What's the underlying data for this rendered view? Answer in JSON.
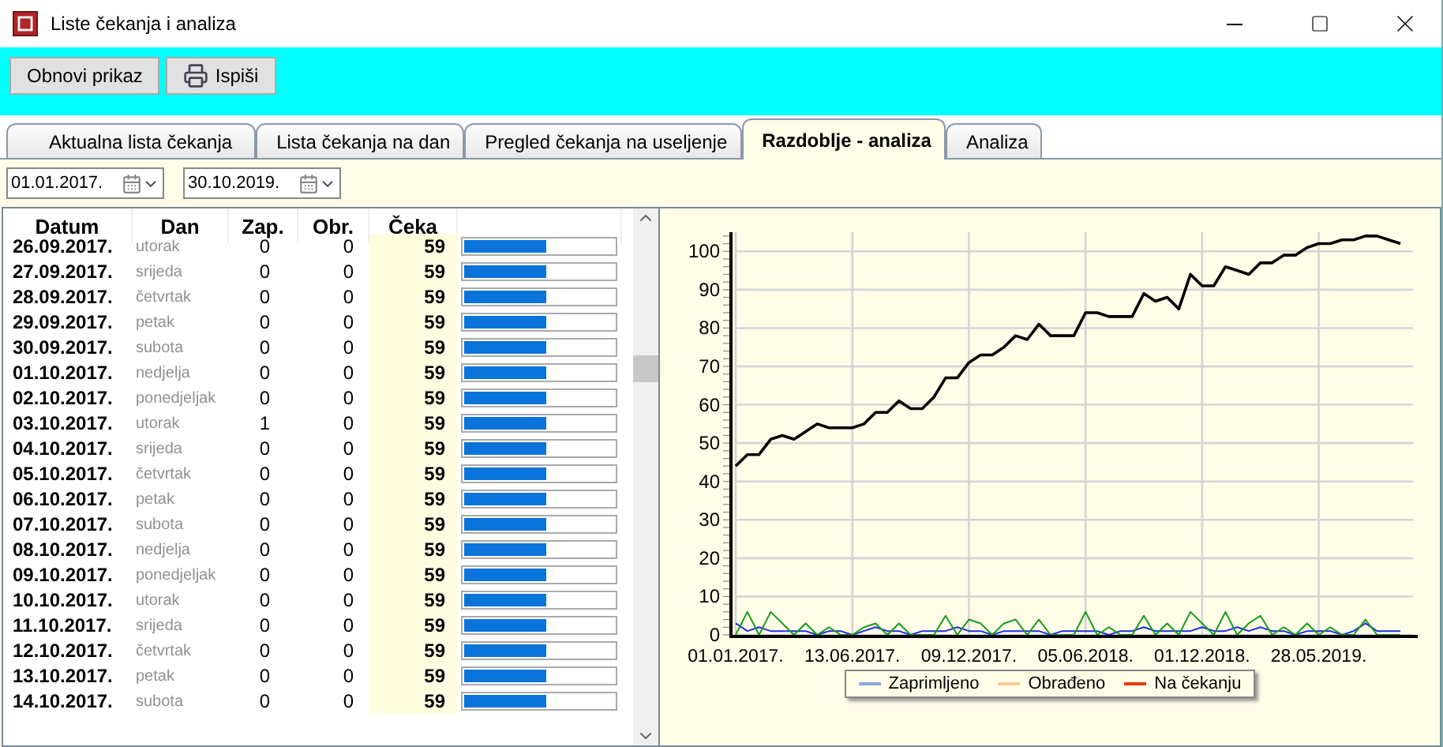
{
  "window": {
    "title": "Liste čekanja i analiza"
  },
  "toolbar": {
    "buttons": [
      {
        "label": "Obnovi prikaz",
        "kind": "text"
      },
      {
        "label": "Ispiši",
        "kind": "print"
      }
    ]
  },
  "tabs": [
    {
      "label": "Aktualna lista čekanja",
      "selected": false
    },
    {
      "label": "Lista čekanja na dan",
      "selected": false
    },
    {
      "label": "Pregled čekanja na useljenje",
      "selected": false
    },
    {
      "label": "Razdoblje - analiza",
      "selected": true
    },
    {
      "label": "Analiza",
      "selected": false
    }
  ],
  "date_from": {
    "value": "01.01.2017."
  },
  "date_to": {
    "value": "30.10.2019."
  },
  "table": {
    "columns": [
      "Datum",
      "Dan",
      "Zap.",
      "Obr.",
      "Čeka"
    ],
    "rows": [
      {
        "date": "26.09.2017.",
        "day": "utorak",
        "zap": "0",
        "obr": "0",
        "ceka": "59",
        "level": 0.55
      },
      {
        "date": "27.09.2017.",
        "day": "srijeda",
        "zap": "0",
        "obr": "0",
        "ceka": "59",
        "level": 0.55
      },
      {
        "date": "28.09.2017.",
        "day": "četvrtak",
        "zap": "0",
        "obr": "0",
        "ceka": "59",
        "level": 0.55
      },
      {
        "date": "29.09.2017.",
        "day": "petak",
        "zap": "0",
        "obr": "0",
        "ceka": "59",
        "level": 0.55
      },
      {
        "date": "30.09.2017.",
        "day": "subota",
        "zap": "0",
        "obr": "0",
        "ceka": "59",
        "level": 0.55
      },
      {
        "date": "01.10.2017.",
        "day": "nedjelja",
        "zap": "0",
        "obr": "0",
        "ceka": "59",
        "level": 0.55
      },
      {
        "date": "02.10.2017.",
        "day": "ponedjeljak",
        "zap": "0",
        "obr": "0",
        "ceka": "59",
        "level": 0.55
      },
      {
        "date": "03.10.2017.",
        "day": "utorak",
        "zap": "1",
        "obr": "0",
        "ceka": "59",
        "level": 0.55
      },
      {
        "date": "04.10.2017.",
        "day": "srijeda",
        "zap": "0",
        "obr": "0",
        "ceka": "59",
        "level": 0.55
      },
      {
        "date": "05.10.2017.",
        "day": "četvrtak",
        "zap": "0",
        "obr": "0",
        "ceka": "59",
        "level": 0.55
      },
      {
        "date": "06.10.2017.",
        "day": "petak",
        "zap": "0",
        "obr": "0",
        "ceka": "59",
        "level": 0.55
      },
      {
        "date": "07.10.2017.",
        "day": "subota",
        "zap": "0",
        "obr": "0",
        "ceka": "59",
        "level": 0.55
      },
      {
        "date": "08.10.2017.",
        "day": "nedjelja",
        "zap": "0",
        "obr": "0",
        "ceka": "59",
        "level": 0.55
      },
      {
        "date": "09.10.2017.",
        "day": "ponedjeljak",
        "zap": "0",
        "obr": "0",
        "ceka": "59",
        "level": 0.55
      },
      {
        "date": "10.10.2017.",
        "day": "utorak",
        "zap": "0",
        "obr": "0",
        "ceka": "59",
        "level": 0.55
      },
      {
        "date": "11.10.2017.",
        "day": "srijeda",
        "zap": "0",
        "obr": "0",
        "ceka": "59",
        "level": 0.55
      },
      {
        "date": "12.10.2017.",
        "day": "četvrtak",
        "zap": "0",
        "obr": "0",
        "ceka": "59",
        "level": 0.55
      },
      {
        "date": "13.10.2017.",
        "day": "petak",
        "zap": "0",
        "obr": "0",
        "ceka": "59",
        "level": 0.55
      },
      {
        "date": "14.10.2017.",
        "day": "subota",
        "zap": "0",
        "obr": "0",
        "ceka": "59",
        "level": 0.55
      }
    ]
  },
  "chart": {
    "chart_data": {
      "type": "line",
      "categories": [
        "01.01.2017.",
        null,
        null,
        null,
        null,
        null,
        null,
        null,
        null,
        null,
        "13.06.2017.",
        null,
        null,
        null,
        null,
        null,
        null,
        null,
        null,
        null,
        "09.12.2017.",
        null,
        null,
        null,
        null,
        null,
        null,
        null,
        null,
        null,
        "05.06.2018.",
        null,
        null,
        null,
        null,
        null,
        null,
        null,
        null,
        null,
        "01.12.2018.",
        null,
        null,
        null,
        null,
        null,
        null,
        null,
        null,
        null,
        "28.05.2019.",
        null,
        null,
        null,
        null,
        null,
        null,
        null
      ],
      "grid": true,
      "ylim": [
        0,
        105
      ],
      "yticks": [
        0,
        10,
        20,
        30,
        40,
        50,
        60,
        70,
        80,
        90,
        100
      ],
      "series": [
        {
          "color": "#000000",
          "values": [
            44,
            47,
            47,
            51,
            52,
            51,
            53,
            55,
            54,
            54,
            54,
            55,
            58,
            58,
            61,
            59,
            59,
            62,
            67,
            67,
            71,
            73,
            73,
            75,
            78,
            77,
            81,
            78,
            78,
            78,
            84,
            84,
            83,
            83,
            83,
            89,
            87,
            88,
            85,
            94,
            91,
            91,
            96,
            95,
            94,
            97,
            97,
            99,
            99,
            101,
            102,
            102,
            103,
            103,
            104,
            104,
            103,
            102
          ]
        },
        {
          "color": "#1f2fe0",
          "values": [
            3,
            1,
            2,
            1,
            1,
            1,
            1,
            0,
            1,
            1,
            0,
            1,
            2,
            1,
            1,
            0,
            1,
            1,
            1,
            2,
            1,
            1,
            0,
            1,
            1,
            1,
            1,
            0,
            1,
            1,
            1,
            1,
            0,
            1,
            1,
            2,
            1,
            1,
            1,
            1,
            2,
            1,
            1,
            2,
            1,
            2,
            1,
            1,
            0,
            1,
            1,
            1,
            0,
            1,
            3,
            1,
            1,
            1
          ]
        },
        {
          "color": "#1a9a1a",
          "values": [
            0,
            6,
            0,
            6,
            3,
            0,
            3,
            0,
            2,
            0,
            0,
            2,
            3,
            0,
            3,
            0,
            0,
            0,
            5,
            0,
            4,
            3,
            0,
            3,
            4,
            0,
            4,
            0,
            0,
            0,
            6,
            0,
            2,
            0,
            0,
            5,
            0,
            3,
            0,
            6,
            3,
            0,
            6,
            0,
            3,
            5,
            0,
            2,
            0,
            3,
            0,
            2,
            0,
            0,
            4,
            0,
            0,
            0
          ]
        }
      ]
    },
    "legend": [
      {
        "label": "Zaprimljeno",
        "color": "#8ea8e0"
      },
      {
        "label": "Obrađeno",
        "color": "#f8c898"
      },
      {
        "label": "Na čekanju",
        "color": "#e83810"
      }
    ]
  }
}
